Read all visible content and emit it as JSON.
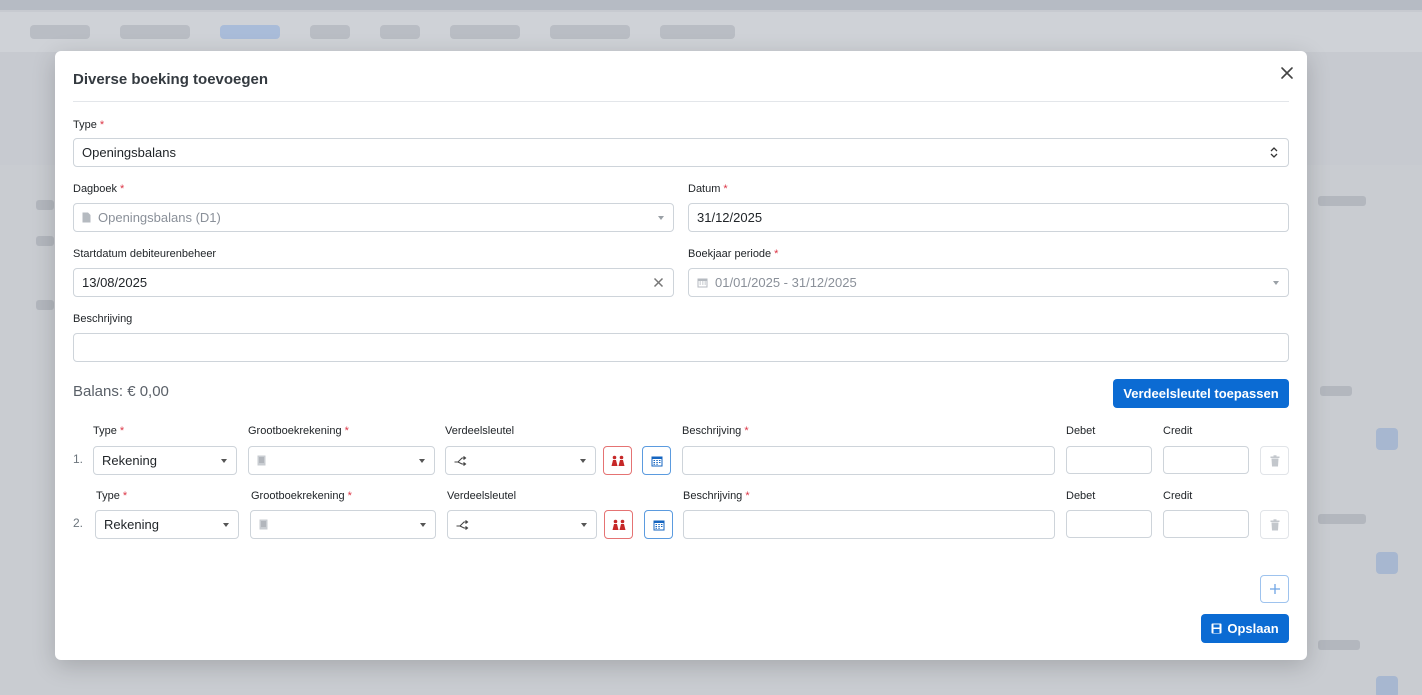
{
  "modal": {
    "title": "Diverse boeking toevoegen"
  },
  "form": {
    "type_label": "Type",
    "type_value": "Openingsbalans",
    "dagboek_label": "Dagboek",
    "dagboek_value": "Openingsbalans (D1)",
    "datum_label": "Datum",
    "datum_value": "31/12/2025",
    "startdatum_label": "Startdatum debiteurenbeheer",
    "startdatum_value": "13/08/2025",
    "boekjaar_label": "Boekjaar periode",
    "boekjaar_value": "01/01/2025 - 31/12/2025",
    "beschrijving_label": "Beschrijving",
    "beschrijving_value": "",
    "required_mark": "*"
  },
  "lines": {
    "balans_text": "Balans: € 0,00",
    "apply_key_button": "Verdeelsleutel toepassen",
    "headers": {
      "type": "Type",
      "grootboek": "Grootboekrekening",
      "verdeelsleutel": "Verdeelsleutel",
      "beschrijving": "Beschrijving",
      "debet": "Debet",
      "credit": "Credit"
    },
    "rows": [
      {
        "num": "1.",
        "type": "Rekening",
        "grootboek": "",
        "verdeelsleutel": "",
        "beschrijving": "",
        "debet": "",
        "credit": ""
      },
      {
        "num": "2.",
        "type": "Rekening",
        "grootboek": "",
        "verdeelsleutel": "",
        "beschrijving": "",
        "debet": "",
        "credit": ""
      }
    ]
  },
  "footer": {
    "save_button": "Opslaan"
  },
  "colors": {
    "primary": "#0b6bd3",
    "danger": "#dc3545"
  },
  "icons": [
    "close-icon",
    "updown-icon",
    "document-icon",
    "clear-icon",
    "calendar-icon",
    "caret-down-icon",
    "ledger-icon",
    "split-icon",
    "people-icon",
    "trash-icon",
    "plus-icon",
    "save-icon"
  ]
}
